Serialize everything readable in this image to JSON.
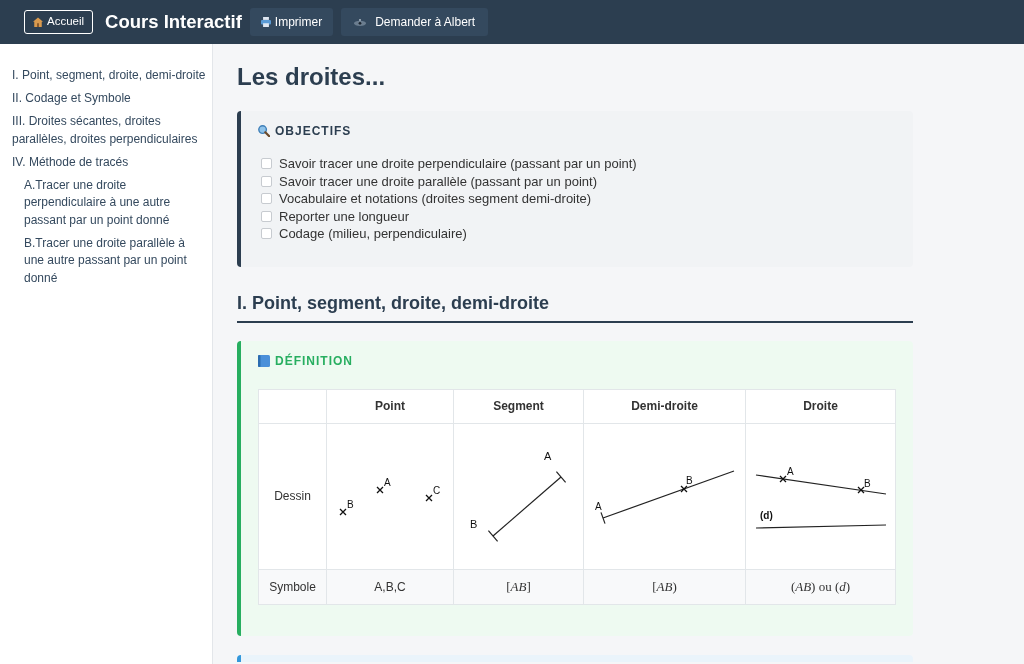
{
  "header": {
    "home_button": "Accueil",
    "title": "Cours Interactif",
    "buttons": [
      {
        "kind": "print",
        "label": "Imprimer"
      },
      {
        "kind": "assistant",
        "label": "Demander à Albert"
      }
    ]
  },
  "sidebar": {
    "items": [
      {
        "label": "I. Point, segment, droite, demi-droite"
      },
      {
        "label": "II. Codage et Symbole"
      },
      {
        "label": "III. Droites sécantes, droites parallèles, droites perpendiculaires"
      },
      {
        "label": "IV. Méthode de tracés",
        "children": [
          {
            "label": "A.Tracer une droite perpendiculaire à une autre passant par un point donné"
          },
          {
            "label": "B.Tracer une droite parallèle à une autre passant par un point donné"
          }
        ]
      }
    ]
  },
  "page_title": "Les droites...",
  "objectives": {
    "title": "OBJECTIFS",
    "items": [
      {
        "label": "Savoir tracer une droite perpendiculaire (passant par un point)",
        "checked": false
      },
      {
        "label": "Savoir tracer une droite parallèle (passant par un point)",
        "checked": false
      },
      {
        "label": "Vocabulaire et notations (droites segment demi-droite)",
        "checked": false
      },
      {
        "label": "Reporter une longueur",
        "checked": false
      },
      {
        "label": "Codage (milieu, perpendiculaire)",
        "checked": false
      }
    ]
  },
  "sections": [
    {
      "heading": "I. Point, segment, droite, demi-droite",
      "definition": {
        "title": "DÉFINITION",
        "table": {
          "columns": [
            "Point",
            "Segment",
            "Demi-droite",
            "Droite"
          ],
          "rows": [
            {
              "kind": "drawing",
              "label": "Dessin",
              "cells": [
                {
                  "kind": "points",
                  "labels": [
                    "A",
                    "B",
                    "C"
                  ]
                },
                {
                  "kind": "segment",
                  "labels": [
                    "A",
                    "B"
                  ]
                },
                {
                  "kind": "ray",
                  "labels": [
                    "A",
                    "B"
                  ]
                },
                {
                  "kind": "lines",
                  "labels": [
                    "A",
                    "B",
                    "(d)"
                  ]
                }
              ]
            },
            {
              "kind": "symbol",
              "label": "Symbole",
              "cells": [
                {
                  "kind": "text",
                  "text": "A,B,C"
                },
                {
                  "kind": "math",
                  "text": "[*AB*]"
                },
                {
                  "kind": "math",
                  "text": "[*AB*)"
                },
                {
                  "kind": "math",
                  "text": "(*AB*) ou (*d*)"
                }
              ]
            }
          ]
        }
      }
    }
  ]
}
